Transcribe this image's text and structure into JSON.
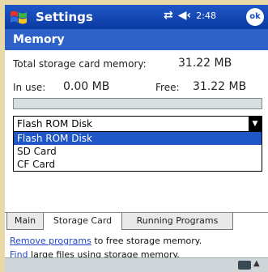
{
  "titlebar": {
    "title": "Settings",
    "time": "2:48",
    "ok_label": "ok"
  },
  "header": {
    "title": "Memory"
  },
  "storage": {
    "total_label": "Total storage card memory:",
    "total_value": "31.22 MB",
    "inuse_label": "In use:",
    "inuse_value": "0.00 MB",
    "free_label": "Free:",
    "free_value": "31.22 MB",
    "used_fraction": 0.0
  },
  "dropdown": {
    "selected": "Flash ROM Disk",
    "options": [
      "Flash ROM Disk",
      "SD Card",
      "CF Card"
    ]
  },
  "tabs": [
    {
      "label": "Main"
    },
    {
      "label": "Storage Card"
    },
    {
      "label": "Running Programs"
    }
  ],
  "links": {
    "remove_link": "Remove programs",
    "remove_rest": "to free storage memory.",
    "find_link": "Find",
    "find_rest": "large files using storage memory."
  },
  "colors": {
    "titlebar": "#1f57c7",
    "header": "#2e62c9",
    "selection": "#1f57c7",
    "link": "#1f47c6"
  }
}
